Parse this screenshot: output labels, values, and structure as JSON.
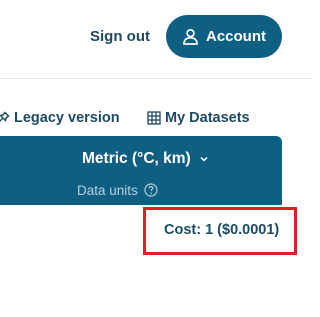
{
  "header": {
    "signout_label": "Sign out",
    "account_label": "Account",
    "account_icon": "user-icon"
  },
  "links": {
    "legacy_label": "Legacy version",
    "legacy_icon": "pin-icon",
    "datasets_label": "My Datasets",
    "datasets_icon": "table-icon"
  },
  "units": {
    "selected": "Metric (°C, km)",
    "caption": "Data units",
    "help_icon": "question-circle-icon"
  },
  "cost": {
    "label": "Cost: 1 ($0.0001)",
    "highlight_color": "#e21d24"
  },
  "colors": {
    "brand": "#0f5f83",
    "text_dark": "#1d4a63",
    "caption": "#b7cfdc"
  }
}
